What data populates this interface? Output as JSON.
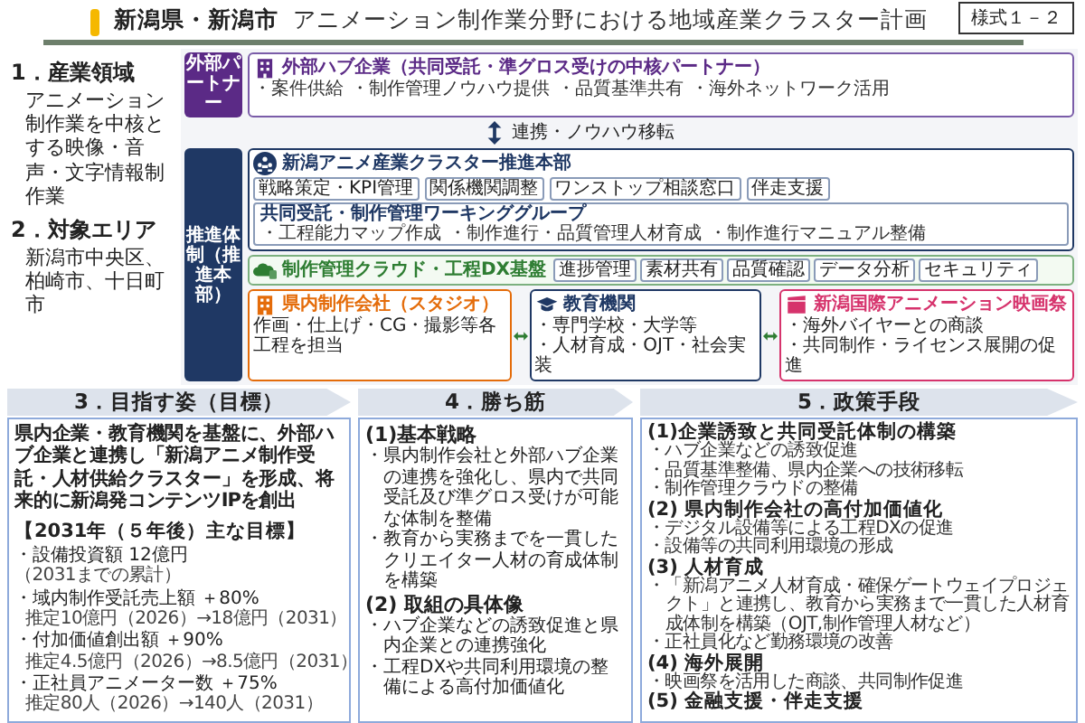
{
  "header": {
    "region": "新潟県・新潟市",
    "title": "アニメーション制作業分野における地域産業クラスター計画",
    "form_number": "様式１－２"
  },
  "overview": [
    {
      "heading": "1．産業領域",
      "text": "アニメーション制作業を中核とする映像・音声・文字情報制作業"
    },
    {
      "heading": "2．対象エリア",
      "text": "新潟市中央区、柏崎市、十日町市"
    }
  ],
  "diagram": {
    "partner_label": "外部パートナー",
    "hub": {
      "title": "外部ハブ企業（共同受託・準グロス受けの中核パートナー）",
      "items": [
        "・案件供給",
        "・制作管理ノウハウ提供",
        "・品質基準共有",
        "・海外ネットワーク活用"
      ]
    },
    "link_label": "連携・ノウハウ移転",
    "promotion_label": "推進体制（推進本部）",
    "headquarters": {
      "title": "新潟アニメ産業クラスター推進本部",
      "tasks": [
        "戦略策定・KPI管理",
        "関係機関調整",
        "ワンストップ相談窓口",
        "伴走支援"
      ]
    },
    "working_group": {
      "title": "共同受託・制作管理ワーキンググループ",
      "items": [
        "・工程能力マップ作成",
        "・制作進行・品質管理人材育成",
        "・制作進行マニュアル整備"
      ]
    },
    "cloud": {
      "title": "制作管理クラウド・工程DX基盤",
      "features": [
        "進捗管理",
        "素材共有",
        "品質確認",
        "データ分析",
        "セキュリティ"
      ]
    },
    "members": [
      {
        "kind": "studio",
        "title": "県内制作会社（スタジオ）",
        "items": [
          "作画・仕上げ・CG・撮影等各工程を担当"
        ]
      },
      {
        "kind": "education",
        "title": "教育機関",
        "items": [
          "・専門学校・大学等",
          "・人材育成・OJT・社会実装"
        ]
      },
      {
        "kind": "festival",
        "title": "新潟国際アニメーション映画祭",
        "items": [
          "・海外バイヤーとの商談",
          "・共同制作・ライセンス展開の促進"
        ]
      }
    ]
  },
  "vision": {
    "heading": "3．目指す姿（目標）",
    "statement": "県内企業・教育機関を基盤に、外部ハブ企業と連携し「新潟アニメ制作受託・人材供給クラスター」を形成、将来的に新潟発コンテンツIPを創出",
    "goals_title": "【2031年（５年後）主な目標】",
    "goals": [
      {
        "text": "・設備投資額 12億円",
        "note": "（2031までの累計）",
        "note_inline": true
      },
      {
        "text": "・域内制作受託売上額 ＋80%",
        "note": "推定10億円（2026）→18億円（2031）",
        "note_inline": false
      },
      {
        "text": "・付加価値創出額 ＋90%",
        "note": "推定4.5億円（2026）→8.5億円（2031）",
        "note_inline": false
      },
      {
        "text": "・正社員アニメーター数 ＋75%",
        "note": "推定80人（2026）→140人（2031）",
        "note_inline": false
      }
    ]
  },
  "strategy": {
    "heading": "4．勝ち筋",
    "groups": [
      {
        "title": "(1)基本戦略",
        "bullets": [
          "・県内制作会社と外部ハブ企業の連携を強化し、県内で共同受託及び準グロス受けが可能な体制を整備",
          "・教育から実務までを一貫したクリエイター人材の育成体制を構築"
        ]
      },
      {
        "title": "(2) 取組の具体像",
        "bullets": [
          "・ハブ企業などの誘致促進と県内企業との連携強化",
          "・工程DXや共同利用環境の整備による高付加価値化"
        ]
      }
    ]
  },
  "policy": {
    "heading": "5．政策手段",
    "groups": [
      {
        "title": "(1)企業誘致と共同受託体制の構築",
        "bullets": [
          "・ハブ企業などの誘致促進",
          "・品質基準整備、県内企業への技術移転",
          "・制作管理クラウドの整備"
        ]
      },
      {
        "title": "(2) 県内制作会社の高付加価値化",
        "bullets": [
          "・デジタル設備等による工程DXの促進",
          "・設備等の共同利用環境の形成"
        ]
      },
      {
        "title": "(3) 人材育成",
        "bullets": [
          "・「新潟アニメ人材育成・確保ゲートウェイプロジェクト」と連携し、教育から実務まで一貫した人材育成体制を構築（OJT,制作管理人材など）",
          "・正社員化など勤務環境の改善"
        ]
      },
      {
        "title": "(4) 海外展開",
        "bullets": [
          "・映画祭を活用した商談、共同制作促進"
        ]
      },
      {
        "title": "(5) 金融支援・伴走支援"
      }
    ]
  }
}
